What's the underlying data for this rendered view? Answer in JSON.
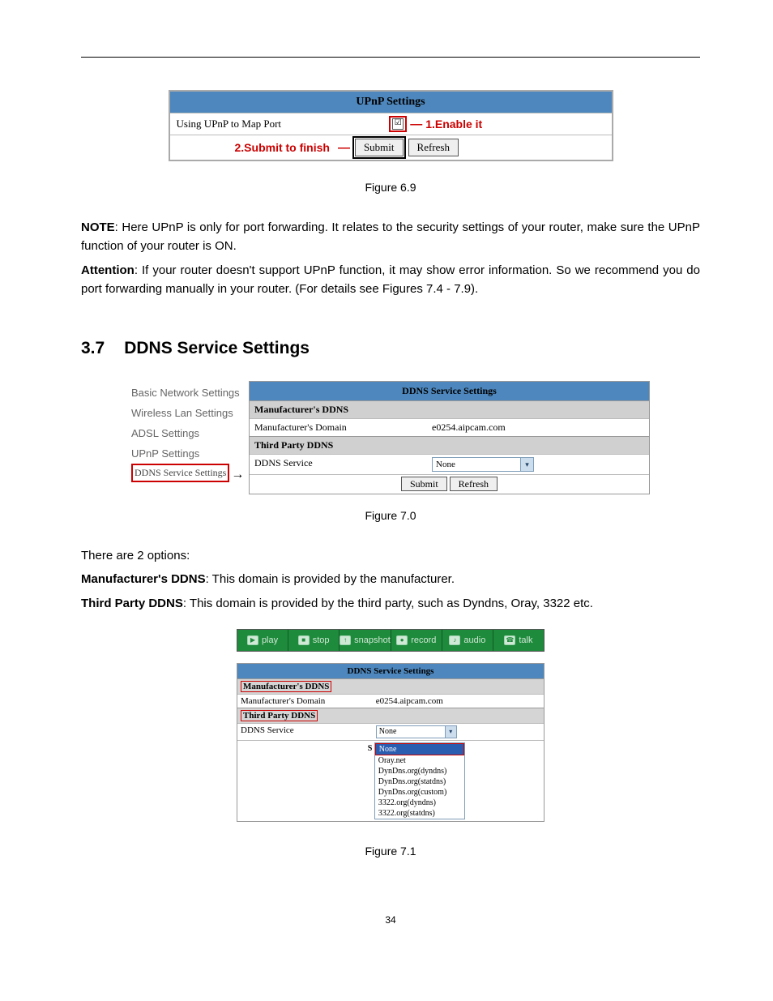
{
  "fig69": {
    "title": "UPnP Settings",
    "row_label": "Using UPnP to Map Port",
    "checkbox_checked": "☑",
    "ann_enable": "1.Enable it",
    "ann_submit": "2.Submit to finish",
    "btn_submit": "Submit",
    "btn_refresh": "Refresh",
    "caption": "Figure 6.9"
  },
  "note": {
    "label": "NOTE",
    "text": ": Here UPnP is only for port forwarding. It relates to the security settings of your router, make sure the UPnP function of your router is ON."
  },
  "attention": {
    "label": "Attention",
    "text": ": If your router doesn't support UPnP function, it may show error information. So we recommend you do port forwarding manually in your router. (For details see Figures 7.4 - 7.9)."
  },
  "section": {
    "num": "3.7",
    "title": "DDNS Service Settings"
  },
  "fig70": {
    "sidebar": [
      "Basic Network Settings",
      "Wireless Lan Settings",
      "ADSL Settings",
      "UPnP Settings",
      "DDNS Service Settings"
    ],
    "head": "DDNS Service Settings",
    "sub1": "Manufacturer's DDNS",
    "row1_l": "Manufacturer's Domain",
    "row1_r": "e0254.aipcam.com",
    "sub2": "Third Party DDNS",
    "row2_l": "DDNS Service",
    "row2_sel": "None",
    "btn_submit": "Submit",
    "btn_refresh": "Refresh",
    "caption": "Figure 7.0"
  },
  "body70": {
    "intro": "There are 2 options:",
    "opt1_label": "Manufacturer's DDNS",
    "opt1_text": ": This domain is provided by the manufacturer.",
    "opt2_label": "Third Party DDNS",
    "opt2_text": ": This domain is provided by the third party, such as Dyndns, Oray, 3322 etc."
  },
  "fig71": {
    "toolbar": [
      "play",
      "stop",
      "snapshot",
      "record",
      "audio",
      "talk"
    ],
    "icons": [
      "▶",
      "■",
      "↑",
      "●",
      "♪",
      "☎"
    ],
    "head": "DDNS Service Settings",
    "sub1": "Manufacturer's DDNS",
    "row1_l": "Manufacturer's Domain",
    "row1_r": "e0254.aipcam.com",
    "sub2": "Third Party DDNS",
    "row2_l": "DDNS Service",
    "row2_sel": "None",
    "s_mark": "S",
    "options": [
      "None",
      "Oray.net",
      "DynDns.org(dyndns)",
      "DynDns.org(statdns)",
      "DynDns.org(custom)",
      "3322.org(dyndns)",
      "3322.org(statdns)"
    ],
    "caption": "Figure 7.1"
  },
  "page_number": "34"
}
